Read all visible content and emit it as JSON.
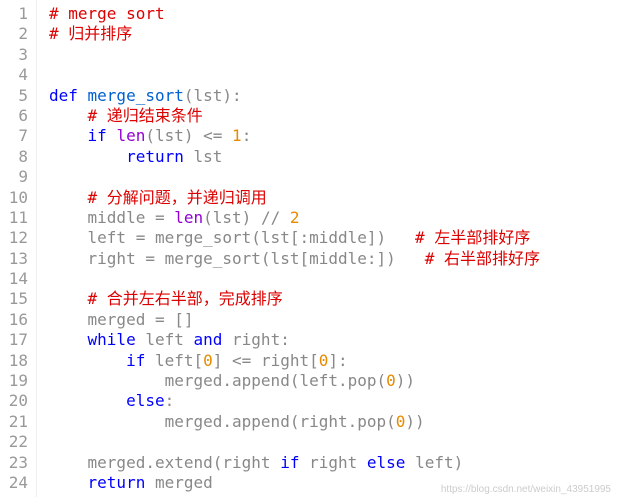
{
  "lines": [
    {
      "num": "1",
      "indent": 0,
      "segs": [
        {
          "cls": "tok-comment",
          "t": "# merge sort"
        }
      ]
    },
    {
      "num": "2",
      "indent": 0,
      "segs": [
        {
          "cls": "tok-comment",
          "t": "# 归并排序"
        }
      ]
    },
    {
      "num": "3",
      "indent": 0,
      "segs": []
    },
    {
      "num": "4",
      "indent": 0,
      "segs": []
    },
    {
      "num": "5",
      "indent": 0,
      "segs": [
        {
          "cls": "tok-keyword",
          "t": "def "
        },
        {
          "cls": "tok-funcname",
          "t": "merge_sort"
        },
        {
          "cls": "tok-punct",
          "t": "(lst):"
        }
      ]
    },
    {
      "num": "6",
      "indent": 1,
      "segs": [
        {
          "cls": "tok-comment",
          "t": "# 递归结束条件"
        }
      ]
    },
    {
      "num": "7",
      "indent": 1,
      "segs": [
        {
          "cls": "tok-keyword",
          "t": "if "
        },
        {
          "cls": "tok-builtin",
          "t": "len"
        },
        {
          "cls": "tok-punct",
          "t": "(lst) <= "
        },
        {
          "cls": "tok-number",
          "t": "1"
        },
        {
          "cls": "tok-punct",
          "t": ":"
        }
      ]
    },
    {
      "num": "8",
      "indent": 2,
      "segs": [
        {
          "cls": "tok-keyword",
          "t": "return "
        },
        {
          "cls": "tok-punct",
          "t": "lst"
        }
      ]
    },
    {
      "num": "9",
      "indent": 0,
      "segs": []
    },
    {
      "num": "10",
      "indent": 1,
      "segs": [
        {
          "cls": "tok-comment",
          "t": "# 分解问题，并递归调用"
        }
      ]
    },
    {
      "num": "11",
      "indent": 1,
      "segs": [
        {
          "cls": "tok-punct",
          "t": "middle = "
        },
        {
          "cls": "tok-builtin",
          "t": "len"
        },
        {
          "cls": "tok-punct",
          "t": "(lst) // "
        },
        {
          "cls": "tok-number",
          "t": "2"
        }
      ]
    },
    {
      "num": "12",
      "indent": 1,
      "segs": [
        {
          "cls": "tok-punct",
          "t": "left = merge_sort(lst[:middle])   "
        },
        {
          "cls": "tok-comment",
          "t": "# 左半部排好序"
        }
      ]
    },
    {
      "num": "13",
      "indent": 1,
      "segs": [
        {
          "cls": "tok-punct",
          "t": "right = merge_sort(lst[middle:])   "
        },
        {
          "cls": "tok-comment",
          "t": "# 右半部排好序"
        }
      ]
    },
    {
      "num": "14",
      "indent": 0,
      "segs": []
    },
    {
      "num": "15",
      "indent": 1,
      "segs": [
        {
          "cls": "tok-comment",
          "t": "# 合并左右半部，完成排序"
        }
      ]
    },
    {
      "num": "16",
      "indent": 1,
      "segs": [
        {
          "cls": "tok-punct",
          "t": "merged = []"
        }
      ]
    },
    {
      "num": "17",
      "indent": 1,
      "segs": [
        {
          "cls": "tok-keyword",
          "t": "while "
        },
        {
          "cls": "tok-punct",
          "t": "left "
        },
        {
          "cls": "tok-keyword",
          "t": "and "
        },
        {
          "cls": "tok-punct",
          "t": "right:"
        }
      ]
    },
    {
      "num": "18",
      "indent": 2,
      "segs": [
        {
          "cls": "tok-keyword",
          "t": "if "
        },
        {
          "cls": "tok-punct",
          "t": "left["
        },
        {
          "cls": "tok-number",
          "t": "0"
        },
        {
          "cls": "tok-punct",
          "t": "] <= right["
        },
        {
          "cls": "tok-number",
          "t": "0"
        },
        {
          "cls": "tok-punct",
          "t": "]:"
        }
      ]
    },
    {
      "num": "19",
      "indent": 3,
      "segs": [
        {
          "cls": "tok-punct",
          "t": "merged.append(left.pop("
        },
        {
          "cls": "tok-number",
          "t": "0"
        },
        {
          "cls": "tok-punct",
          "t": "))"
        }
      ]
    },
    {
      "num": "20",
      "indent": 2,
      "segs": [
        {
          "cls": "tok-keyword",
          "t": "else"
        },
        {
          "cls": "tok-punct",
          "t": ":"
        }
      ]
    },
    {
      "num": "21",
      "indent": 3,
      "segs": [
        {
          "cls": "tok-punct",
          "t": "merged.append(right.pop("
        },
        {
          "cls": "tok-number",
          "t": "0"
        },
        {
          "cls": "tok-punct",
          "t": "))"
        }
      ]
    },
    {
      "num": "22",
      "indent": 0,
      "segs": []
    },
    {
      "num": "23",
      "indent": 1,
      "segs": [
        {
          "cls": "tok-punct",
          "t": "merged.extend(right "
        },
        {
          "cls": "tok-keyword",
          "t": "if "
        },
        {
          "cls": "tok-punct",
          "t": "right "
        },
        {
          "cls": "tok-keyword",
          "t": "else "
        },
        {
          "cls": "tok-punct",
          "t": "left)"
        }
      ]
    },
    {
      "num": "24",
      "indent": 1,
      "segs": [
        {
          "cls": "tok-keyword",
          "t": "return "
        },
        {
          "cls": "tok-punct",
          "t": "merged"
        }
      ]
    }
  ],
  "watermark": "https://blog.csdn.net/weixin_43951995",
  "indent_unit": "    "
}
